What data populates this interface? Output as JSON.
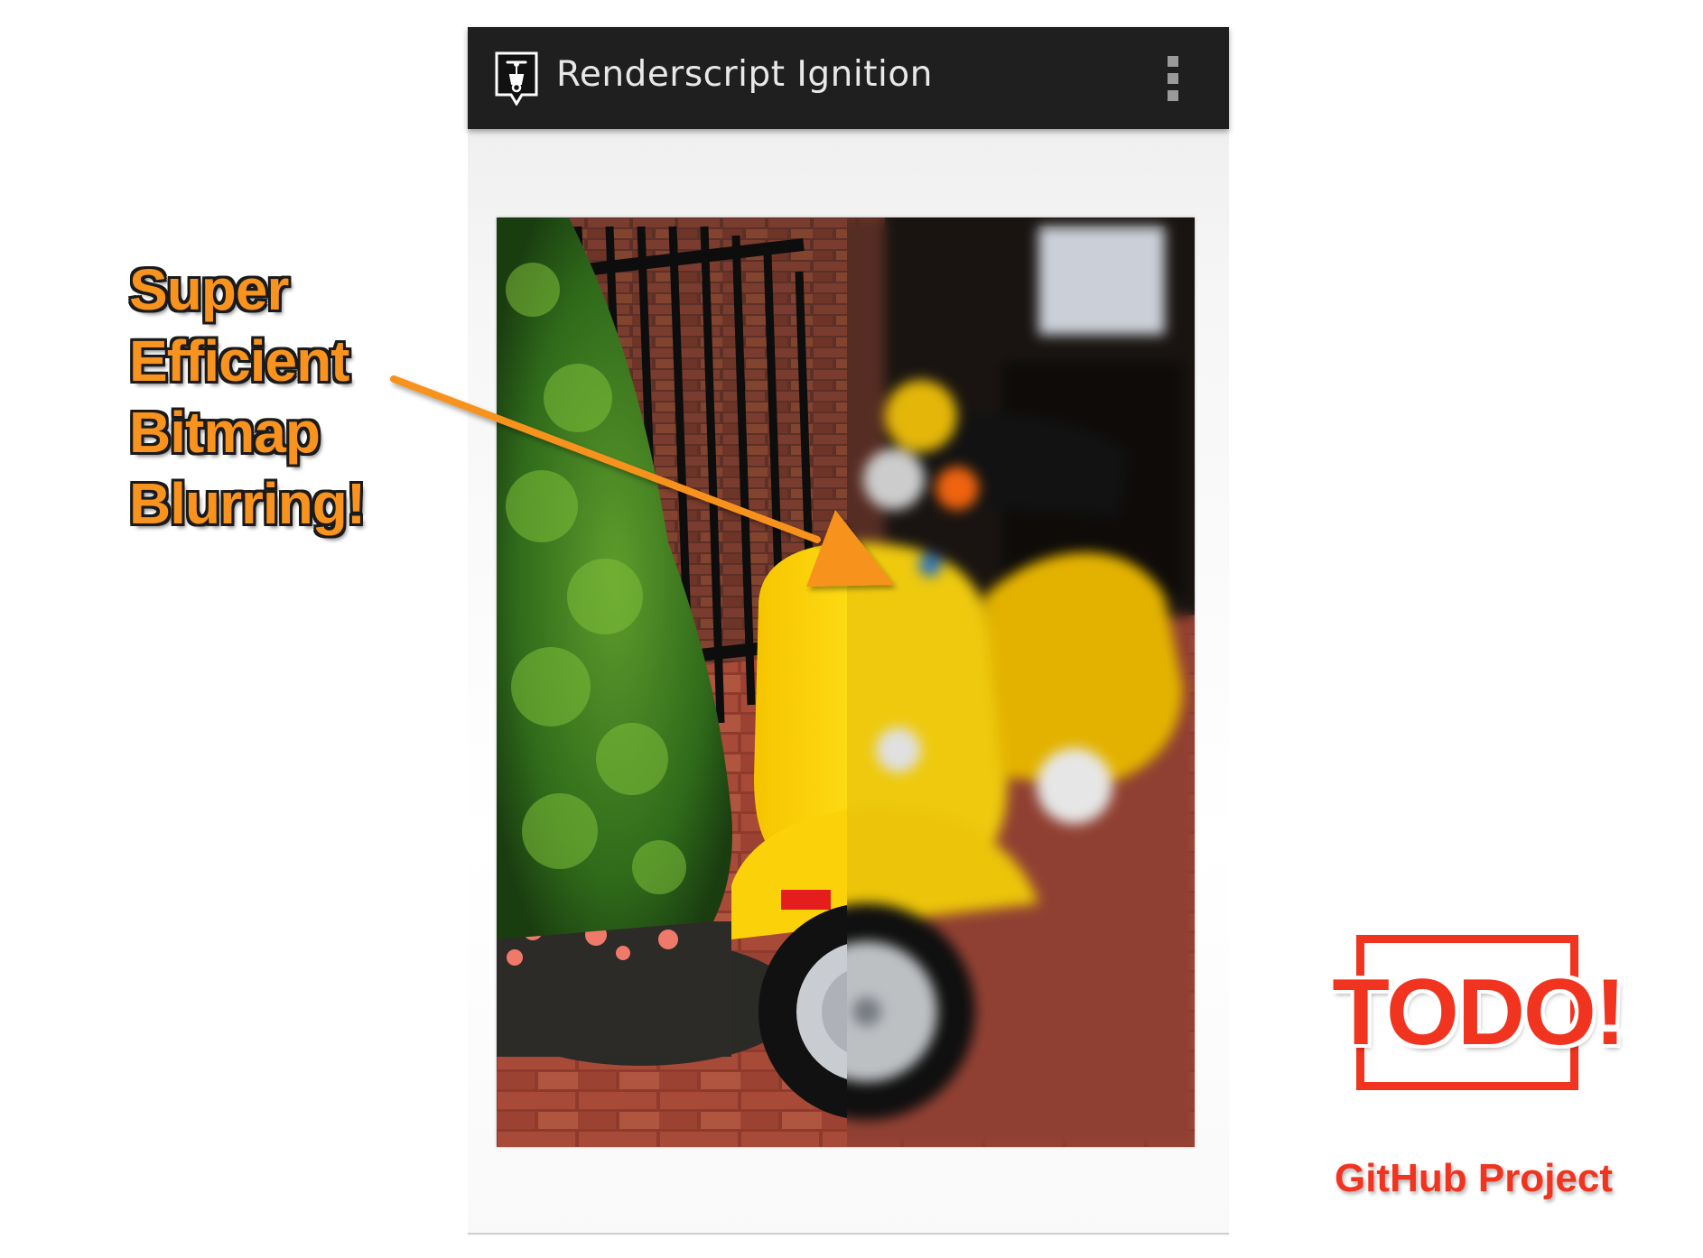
{
  "app": {
    "title": "Renderscript Ignition",
    "icon": "scooter-app-icon",
    "overflow_icon": "overflow-menu-icon"
  },
  "photo": {
    "subject": "yellow scooter photo",
    "left_half": "sharp",
    "right_half": "blurred"
  },
  "annotation": {
    "lines": [
      "Super",
      "Efficient",
      "Bitmap",
      "Blurring!"
    ],
    "color": "#f7931e"
  },
  "todo": {
    "label": "TODO!",
    "color": "#f0341f"
  },
  "github": {
    "label": "GitHub Project"
  }
}
